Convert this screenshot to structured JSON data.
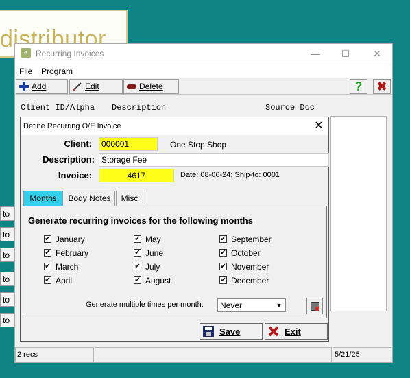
{
  "background_app": {
    "logo_text": "distributor",
    "side_button_label": "to"
  },
  "window": {
    "title": "Recurring Invoices",
    "icon_text": "e",
    "controls": {
      "minimize": "—",
      "maximize": "☐",
      "close": "✕"
    }
  },
  "menu": [
    "File",
    "Program"
  ],
  "toolbar": {
    "add_label": "Add",
    "edit_label": "Edit",
    "delete_label": "Delete",
    "help_label": "?",
    "close_label": "✖"
  },
  "list": {
    "columns": [
      "Client ID/Alpha",
      "Description",
      "Source Doc"
    ]
  },
  "status": {
    "records": "2 recs",
    "date": "5/21/25"
  },
  "dialog": {
    "title": "Define Recurring O/E Invoice",
    "close": "✕",
    "client_label": "Client:",
    "client_value": "000001",
    "client_name": "One Stop Shop",
    "description_label": "Description:",
    "description_value": "Storage Fee",
    "invoice_label": "Invoice:",
    "invoice_value": "4617",
    "invoice_info": "Date: 08-06-24; Ship-to: 0001",
    "tabs": [
      "Months",
      "Body Notes",
      "Misc"
    ],
    "active_tab": "Months",
    "months_heading": "Generate recurring invoices for the following months",
    "months": [
      {
        "name": "January",
        "checked": true
      },
      {
        "name": "February",
        "checked": true
      },
      {
        "name": "March",
        "checked": true
      },
      {
        "name": "April",
        "checked": true
      },
      {
        "name": "May",
        "checked": true
      },
      {
        "name": "June",
        "checked": true
      },
      {
        "name": "July",
        "checked": true
      },
      {
        "name": "August",
        "checked": true
      },
      {
        "name": "September",
        "checked": true
      },
      {
        "name": "October",
        "checked": true
      },
      {
        "name": "November",
        "checked": true
      },
      {
        "name": "December",
        "checked": true
      }
    ],
    "multiple_label": "Generate multiple times per month:",
    "multiple_value": "Never",
    "save_label": "Save",
    "exit_label": "Exit"
  },
  "colors": {
    "desktop": "#0e8384",
    "field_highlight": "#ffff1a",
    "active_tab": "#33d0ec"
  }
}
